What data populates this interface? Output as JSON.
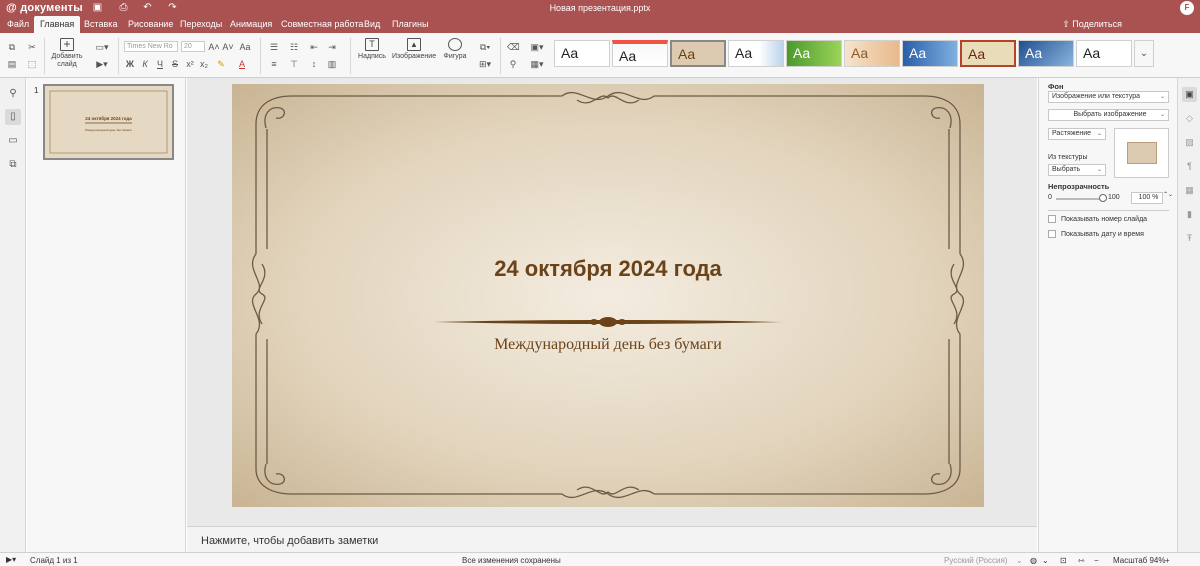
{
  "app": {
    "logo": "документы",
    "doc_title": "Новая презентация.pptx",
    "avatar": "F"
  },
  "menu": {
    "tabs": [
      "Файл",
      "Главная",
      "Вставка",
      "Рисование",
      "Переходы",
      "Анимация",
      "Совместная работа",
      "Вид",
      "Плагины"
    ],
    "share": "Поделиться"
  },
  "toolbar": {
    "add_slide": "Добавить слайд",
    "font_name": "Times New Ro",
    "font_size": "20",
    "caption": "Надпись",
    "image": "Изображение",
    "shape": "Фигура",
    "theme_label": "Aa"
  },
  "slides": [
    {
      "number": "1",
      "title": "24 октября 2024 года",
      "subtitle": "Международный день без бумаги"
    }
  ],
  "notes_placeholder": "Нажмите, чтобы добавить заметки",
  "right_panel": {
    "section_bg": "Фон",
    "fill_type": "Изображение или текстура",
    "choose_image": "Выбрать изображение",
    "stretch": "Растяжение",
    "from_texture": "Из текстуры",
    "texture_select": "Выбрать",
    "opacity_label": "Непрозрачность",
    "opacity_min": "0",
    "opacity_max": "100",
    "opacity_value": "100 %",
    "show_slide_number": "Показывать номер слайда",
    "show_date_time": "Показывать дату и время"
  },
  "status": {
    "slide_of": "Слайд 1 из 1",
    "saved": "Все изменения сохранены",
    "language": "Русский (Россия)",
    "zoom": "Масштаб 94%"
  },
  "colors": {
    "accent": "#aa5252",
    "slide_text": "#6b4319",
    "slide_bg": "#e3d6c0"
  }
}
